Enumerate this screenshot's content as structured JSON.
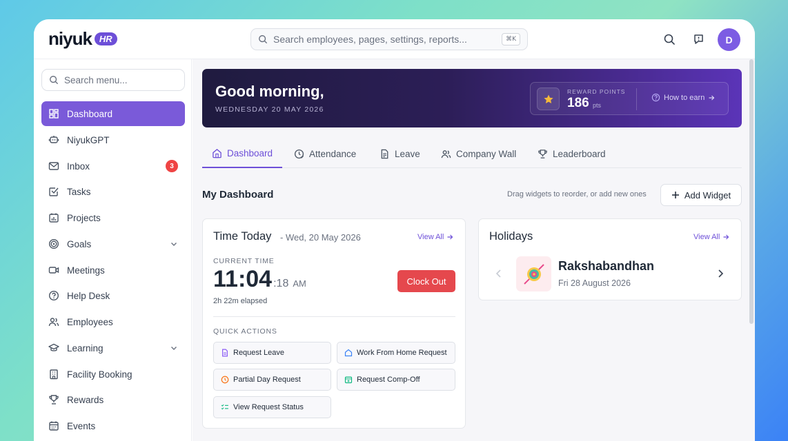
{
  "app": {
    "logo_text": "niyuk",
    "logo_badge": "HR"
  },
  "header": {
    "search_placeholder": "Search employees, pages, settings, reports...",
    "search_shortcut": "⌘K",
    "avatar_initial": "D"
  },
  "sidebar": {
    "search_placeholder": "Search menu...",
    "items": [
      {
        "label": "Dashboard",
        "icon": "grid-icon",
        "active": true
      },
      {
        "label": "NiyukGPT",
        "icon": "bot-icon"
      },
      {
        "label": "Inbox",
        "icon": "mail-icon",
        "badge": "3"
      },
      {
        "label": "Tasks",
        "icon": "checkbox-icon"
      },
      {
        "label": "Projects",
        "icon": "calendar-chart-icon"
      },
      {
        "label": "Goals",
        "icon": "target-icon",
        "expandable": true
      },
      {
        "label": "Meetings",
        "icon": "video-icon"
      },
      {
        "label": "Help Desk",
        "icon": "help-circle-icon"
      },
      {
        "label": "Employees",
        "icon": "users-icon"
      },
      {
        "label": "Learning",
        "icon": "graduation-cap-icon",
        "expandable": true
      },
      {
        "label": "Facility Booking",
        "icon": "building-icon"
      },
      {
        "label": "Rewards",
        "icon": "trophy-icon"
      },
      {
        "label": "Events",
        "icon": "calendar-icon"
      }
    ]
  },
  "hero": {
    "greeting": "Good morning,",
    "date": "WEDNESDAY 20 MAY 2026",
    "reward_label": "REWARD POINTS",
    "reward_value": "186",
    "reward_unit": "pts",
    "how_to_earn": "How to earn",
    "accent_gradient": [
      "#1f1b3f",
      "#5b34b8"
    ]
  },
  "tabs": [
    {
      "label": "Dashboard",
      "icon": "home-icon",
      "active": true
    },
    {
      "label": "Attendance",
      "icon": "clock-check-icon"
    },
    {
      "label": "Leave",
      "icon": "document-icon"
    },
    {
      "label": "Company Wall",
      "icon": "users-icon"
    },
    {
      "label": "Leaderboard",
      "icon": "trophy-icon"
    }
  ],
  "dashboard": {
    "title": "My Dashboard",
    "hint": "Drag widgets to reorder, or add new ones",
    "add_widget": "Add Widget"
  },
  "time_card": {
    "title": "Time Today",
    "subtitle": "- Wed, 20 May 2026",
    "view_all": "View All",
    "current_time_label": "CURRENT TIME",
    "time_hm": "11:04",
    "time_sec": ":18",
    "time_ampm": "AM",
    "elapsed": "2h 22m elapsed",
    "clock_out": "Clock Out",
    "quick_actions_label": "QUICK ACTIONS",
    "quick_actions": [
      {
        "label": "Request Leave",
        "icon": "document-icon",
        "color": "#8b5cf6"
      },
      {
        "label": "Work From Home Request",
        "icon": "home-icon",
        "color": "#3b82f6"
      },
      {
        "label": "Partial Day Request",
        "icon": "clock-icon",
        "color": "#f97316"
      },
      {
        "label": "Request Comp-Off",
        "icon": "calendar-plus-icon",
        "color": "#10b981"
      },
      {
        "label": "View Request Status",
        "icon": "list-check-icon",
        "color": "#10b981"
      }
    ]
  },
  "holidays_card": {
    "title": "Holidays",
    "view_all": "View All",
    "holiday_name": "Rakshabandhan",
    "holiday_date": "Fri 28 August 2026"
  },
  "colors": {
    "accent": "#6d4fd8",
    "danger": "#e5484d",
    "sidebar_active": "#7a5ad9"
  }
}
